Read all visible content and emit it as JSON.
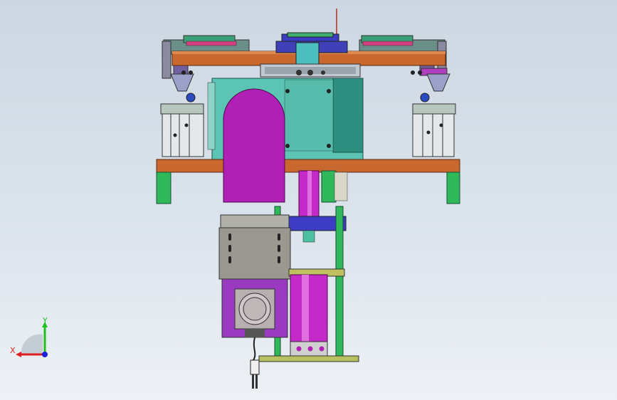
{
  "viewport": {
    "background_top": "#cdd7e2",
    "background_bottom": "#edf1f5"
  },
  "model": {
    "description_colors": {
      "copper_plate": "#c8682e",
      "frame_orange": "#c8682e",
      "teal_block": "#5cc4b4",
      "teal_dark": "#2e8f80",
      "magenta_part": "#b020b4",
      "green_parts": "#2fb85a",
      "gray_block": "#9a9890",
      "purple_motor": "#9a3ac0",
      "blue_bracket": "#3c3cc4",
      "olive_base": "#b8c060"
    }
  },
  "triad": {
    "x_label": "X",
    "y_label": "Y",
    "x_color": "#e02020",
    "y_color": "#20c020",
    "z_color": "#2020e0"
  }
}
